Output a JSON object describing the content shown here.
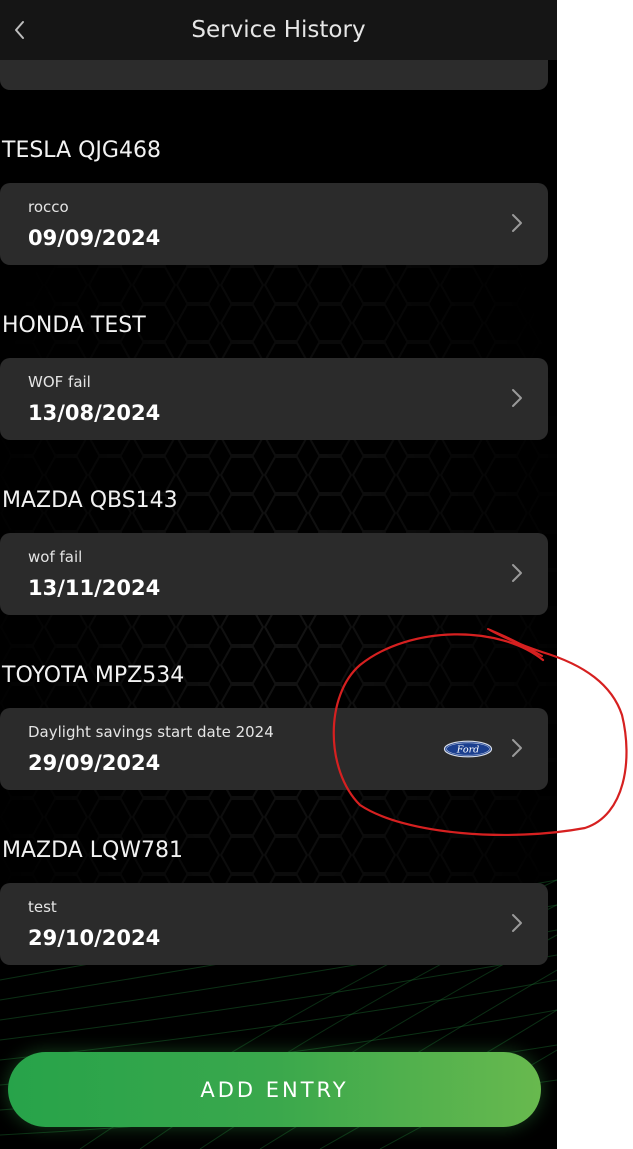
{
  "header": {
    "title": "Service History"
  },
  "vehicles": [
    {
      "name": "TESLA QJG468",
      "entry_title": "rocco",
      "entry_date": "09/09/2024",
      "has_logo": false
    },
    {
      "name": "HONDA TEST",
      "entry_title": "WOF fail",
      "entry_date": "13/08/2024",
      "has_logo": false
    },
    {
      "name": "MAZDA QBS143",
      "entry_title": "wof fail",
      "entry_date": "13/11/2024",
      "has_logo": false
    },
    {
      "name": "TOYOTA MPZ534",
      "entry_title": "Daylight savings start date 2024",
      "entry_date": "29/09/2024",
      "has_logo": true,
      "logo_text": "Ford"
    },
    {
      "name": "MAZDA LQW781",
      "entry_title": "test",
      "entry_date": "29/10/2024",
      "has_logo": false
    }
  ],
  "add_entry": {
    "label": "ADD ENTRY"
  },
  "colors": {
    "background": "#000000",
    "card": "#2b2b2b",
    "header": "#151515",
    "accent_green": "#3aa84c",
    "annotation_red": "#d62020",
    "ford_blue": "#1b3f8f"
  }
}
